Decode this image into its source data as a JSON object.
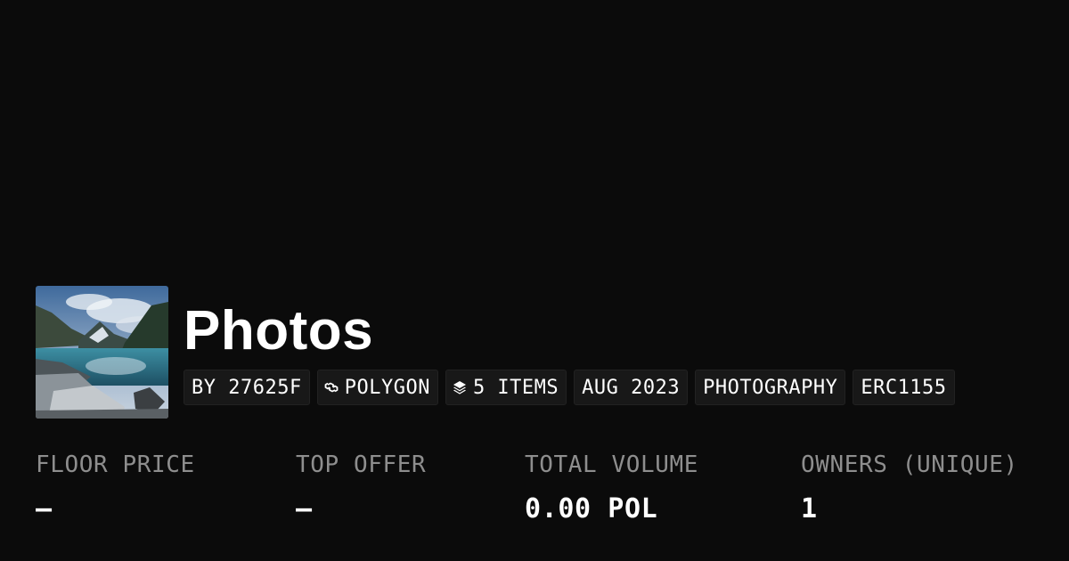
{
  "collection": {
    "title": "Photos",
    "image_alt": "Mountain lake landscape thumbnail"
  },
  "tags": [
    {
      "label": "BY 27625F",
      "icon": ""
    },
    {
      "label": "POLYGON",
      "icon": "polygon-icon"
    },
    {
      "label": "5 ITEMS",
      "icon": "layers-icon"
    },
    {
      "label": "AUG 2023",
      "icon": ""
    },
    {
      "label": "PHOTOGRAPHY",
      "icon": ""
    },
    {
      "label": "ERC1155",
      "icon": ""
    }
  ],
  "stats": [
    {
      "label": "FLOOR PRICE",
      "value": "–"
    },
    {
      "label": "TOP OFFER",
      "value": "–"
    },
    {
      "label": "TOTAL VOLUME",
      "value": "0.00 POL"
    },
    {
      "label": "OWNERS (UNIQUE)",
      "value": "1"
    }
  ],
  "colors": {
    "background": "#0b0b0b",
    "tag_background": "#181818",
    "label_gray": "#8e8e8e",
    "text": "#ffffff"
  }
}
